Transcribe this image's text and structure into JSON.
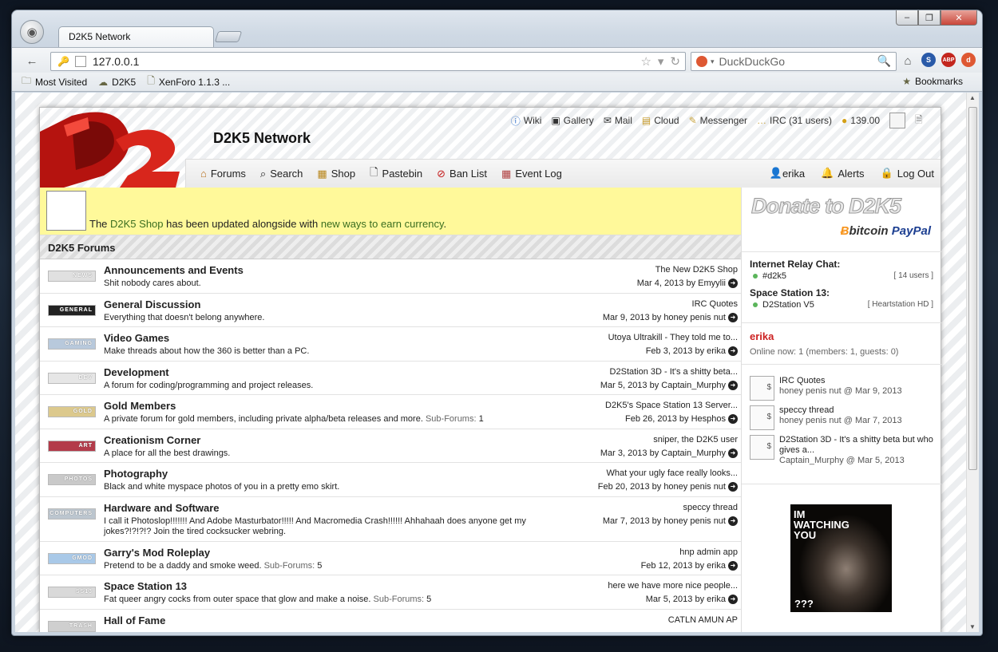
{
  "browser": {
    "tab_title": "D2K5 Network",
    "url": "127.0.0.1",
    "search_engine": "DuckDuckGo",
    "bookmarks": [
      "Most Visited",
      "D2K5",
      "XenForo 1.1.3 ..."
    ],
    "bookmarks_menu": "Bookmarks"
  },
  "site": {
    "title": "D2K5 Network",
    "toplinks": [
      "Wiki",
      "Gallery",
      "Mail",
      "Cloud",
      "Messenger",
      "IRC (31 users)",
      "139.00"
    ],
    "nav": [
      "Forums",
      "Search",
      "Shop",
      "Pastebin",
      "Ban List",
      "Event Log"
    ],
    "nav_right": [
      "erika",
      "Alerts",
      "Log Out"
    ],
    "notice": {
      "pre": "The ",
      "link1": "D2K5 Shop",
      "mid": " has been updated alongside with ",
      "link2": "new ways to earn currency",
      "post": "."
    },
    "forums_header": "D2K5 Forums",
    "forums": [
      {
        "icon": "NEWS",
        "icon_color": "#e0e0e0",
        "name": "Announcements and Events",
        "desc": "Shit nobody cares about.",
        "sub": "",
        "subcount": "",
        "last_title": "The New D2K5 Shop",
        "last_date": "Mar 4, 2013",
        "last_by": "by Emyylii"
      },
      {
        "icon": "GENERAL",
        "icon_color": "#222",
        "name": "General Discussion",
        "desc": "Everything that doesn't belong anywhere.",
        "sub": "",
        "subcount": "",
        "last_title": "IRC Quotes",
        "last_date": "Mar 9, 2013",
        "last_by": "by honey penis nut"
      },
      {
        "icon": "GAMING",
        "icon_color": "#b8c9dc",
        "name": "Video Games",
        "desc": "Make threads about how the 360 is better than a PC.",
        "sub": "",
        "subcount": "",
        "last_title": "Utoya Ultrakill - They told me to...",
        "last_date": "Feb 3, 2013",
        "last_by": "by erika"
      },
      {
        "icon": "DEV",
        "icon_color": "#e6e6e6",
        "name": "Development",
        "desc": "A forum for coding/programming and project releases.",
        "sub": "",
        "subcount": "",
        "last_title": "D2Station 3D - It's a shitty beta...",
        "last_date": "Mar 5, 2013",
        "last_by": "by Captain_Murphy"
      },
      {
        "icon": "GOLD",
        "icon_color": "#dcc98d",
        "name": "Gold Members",
        "desc": "A private forum for gold members, including private alpha/beta releases and more.",
        "sub": "Sub-Forums:",
        "subcount": "1",
        "last_title": "D2K5's Space Station 13 Server...",
        "last_date": "Feb 26, 2013",
        "last_by": "by Hesphos"
      },
      {
        "icon": "ART",
        "icon_color": "#b33b4a",
        "name": "Creationism Corner",
        "desc": "A place for all the best drawings.",
        "sub": "",
        "subcount": "",
        "last_title": "sniper, the D2K5 user",
        "last_date": "Mar 3, 2013",
        "last_by": "by Captain_Murphy"
      },
      {
        "icon": "PHOTOS",
        "icon_color": "#c9c9c9",
        "name": "Photography",
        "desc": "Black and white myspace photos of you in a pretty emo skirt.",
        "sub": "",
        "subcount": "",
        "last_title": "What your ugly face really looks...",
        "last_date": "Feb 20, 2013",
        "last_by": "by honey penis nut"
      },
      {
        "icon": "COMPUTERS",
        "icon_color": "#bcc6cf",
        "name": "Hardware and Software",
        "desc": "I call it Photoslop!!!!!!! And Adobe Masturbator!!!!! And Macromedia Crash!!!!!! Ahhahaah does anyone get my jokes?!?!?!? Join the tired cocksucker webring.",
        "sub": "",
        "subcount": "",
        "last_title": "speccy thread",
        "last_date": "Mar 7, 2013",
        "last_by": "by honey penis nut"
      },
      {
        "icon": "GMOD",
        "icon_color": "#a9c9e8",
        "name": "Garry's Mod Roleplay",
        "desc": "Pretend to be a daddy and smoke weed.",
        "sub": "Sub-Forums:",
        "subcount": "5",
        "last_title": "hnp admin app",
        "last_date": "Feb 12, 2013",
        "last_by": "by erika"
      },
      {
        "icon": "SS13",
        "icon_color": "#d9d9d9",
        "name": "Space Station 13",
        "desc": "Fat queer angry cocks from outer space that glow and make a noise.",
        "sub": "Sub-Forums:",
        "subcount": "5",
        "last_title": "here we have more nice people...",
        "last_date": "Mar 5, 2013",
        "last_by": "by erika"
      },
      {
        "icon": "TRASH",
        "icon_color": "#cfcfcf",
        "name": "Hall of Fame",
        "desc": "",
        "sub": "",
        "subcount": "",
        "last_title": "CATLN AMUN AP",
        "last_date": "",
        "last_by": ""
      }
    ],
    "sidebar": {
      "donate": "Donate to D2K5",
      "bitcoin": "bitcoin",
      "paypal": "PayPal",
      "irc_title": "Internet Relay Chat:",
      "irc_channel": "#d2k5",
      "irc_users": "[ 14 users ]",
      "ss13_title": "Space Station 13:",
      "ss13_server": "D2Station V5",
      "ss13_map": "[ Heartstation HD ]",
      "username": "erika",
      "online": "Online now: 1 (members: 1, guests: 0)",
      "posts": [
        {
          "title": "IRC Quotes",
          "meta": "honey penis nut @ Mar 9, 2013"
        },
        {
          "title": "speccy thread",
          "meta": "honey penis nut @ Mar 7, 2013"
        },
        {
          "title": "D2Station 3D - It's a shitty beta but who gives a...",
          "meta": "Captain_Murphy @ Mar 5, 2013"
        }
      ],
      "watch_text": "IM WATCHING YOU",
      "watch_q": "???"
    }
  }
}
